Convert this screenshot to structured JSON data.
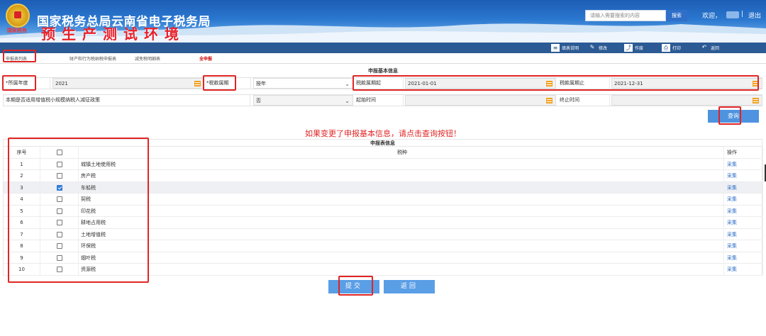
{
  "header": {
    "emblem_label": "国家税务",
    "site_title": "国家税务总局云南省电子税务局",
    "env_title": "预生产测试环境",
    "search_placeholder": "请输入需要搜索的内容",
    "search_button": "搜索",
    "welcome": "欢迎，",
    "separator": "|",
    "logout": "退出"
  },
  "toolbar": {
    "items": [
      {
        "label": "填表说明",
        "icon": "form-guide-icon"
      },
      {
        "label": "修改",
        "icon": "pencil-icon"
      },
      {
        "label": "作废",
        "icon": "void-icon"
      },
      {
        "label": "打印",
        "icon": "printer-icon"
      },
      {
        "label": "返回",
        "icon": "back-arrow-icon"
      }
    ]
  },
  "tabs": [
    "申报表列表",
    "财产和行为税纳税申报表",
    "减免税明细表",
    "全申报"
  ],
  "basic_info": {
    "title": "申报基本信息",
    "year_label": "*所属年度",
    "year_value": "2021",
    "period_label": "*税款属期",
    "period_value": "按年",
    "start_label": "税款属期起",
    "start_value": "2021-01-01",
    "end_label": "税款属期止",
    "end_value": "2021-12-31",
    "policy_label": "本期是否适用增值税小规模纳税人减征政策",
    "policy_value": "否",
    "begin_time_label": "起始时间",
    "end_time_label": "终止时间",
    "begin_time_value": "",
    "end_time_value": "",
    "query_button": "查询"
  },
  "warning": "如果变更了申报基本信息，请点击查询按钮！",
  "table": {
    "title": "申报表信息",
    "headers": {
      "no": "序号",
      "tax": "税种",
      "op": "操作"
    },
    "rows": [
      {
        "no": "1",
        "name": "城镇土地使用税",
        "checked": false,
        "op": "采集"
      },
      {
        "no": "2",
        "name": "房产税",
        "checked": false,
        "op": "采集"
      },
      {
        "no": "3",
        "name": "车船税",
        "checked": true,
        "op": "采集"
      },
      {
        "no": "4",
        "name": "契税",
        "checked": false,
        "op": "采集"
      },
      {
        "no": "5",
        "name": "印花税",
        "checked": false,
        "op": "采集"
      },
      {
        "no": "6",
        "name": "耕地占用税",
        "checked": false,
        "op": "采集"
      },
      {
        "no": "7",
        "name": "土地增值税",
        "checked": false,
        "op": "采集"
      },
      {
        "no": "8",
        "name": "环保税",
        "checked": false,
        "op": "采集"
      },
      {
        "no": "9",
        "name": "烟叶税",
        "checked": false,
        "op": "采集"
      },
      {
        "no": "10",
        "name": "资源税",
        "checked": false,
        "op": "采集"
      }
    ]
  },
  "footer": {
    "submit": "提交",
    "back": "返回"
  },
  "colors": {
    "accent": "#2c5a94",
    "highlight": "#e02525",
    "button": "#5a9ee6"
  }
}
